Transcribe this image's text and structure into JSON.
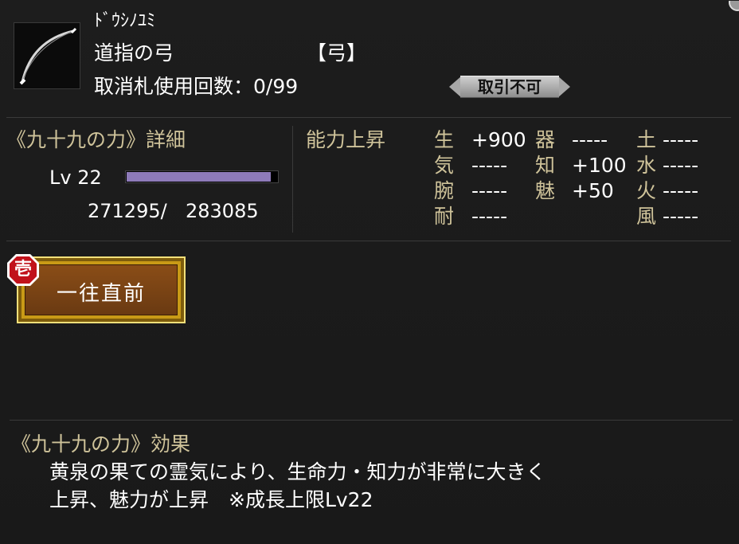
{
  "item": {
    "reading": "ﾄﾞｳｼﾉﾕﾐ",
    "name": "道指の弓",
    "category": "【弓】",
    "cancel_label": "取消札使用回数",
    "cancel_sep": "：",
    "cancel_count": "0/99",
    "trade_status": "取引不可",
    "icon": "bow-icon"
  },
  "power": {
    "title": "《九十九の力》詳細",
    "lv_label": "Lv",
    "lv_value": "22",
    "exp_current": "271295/",
    "exp_max": "283085",
    "exp_fraction": 0.958
  },
  "stats": {
    "header": "能力上昇",
    "rows": [
      [
        {
          "k": "生",
          "v": "+900"
        },
        {
          "k": "器",
          "v": "-----"
        },
        {
          "k": "土",
          "v": "-----"
        }
      ],
      [
        {
          "k": "気",
          "v": "-----"
        },
        {
          "k": "知",
          "v": "+100"
        },
        {
          "k": "水",
          "v": "-----"
        }
      ],
      [
        {
          "k": "腕",
          "v": "-----"
        },
        {
          "k": "魅",
          "v": "+50"
        },
        {
          "k": "火",
          "v": "-----"
        }
      ],
      [
        {
          "k": "耐",
          "v": "-----"
        },
        {
          "k": "",
          "v": ""
        },
        {
          "k": "風",
          "v": "-----"
        }
      ]
    ]
  },
  "skill": {
    "rank_badge": "壱",
    "label": "一往直前"
  },
  "effect": {
    "title": "《九十九の力》効果",
    "line1": "黄泉の果ての霊気により、生命力・知力が非常に大きく",
    "line2": "上昇、魅力が上昇　※成長上限Lv22"
  },
  "colors": {
    "background": "#1b1b1b",
    "header_text": "#cfc39a",
    "exp_bar": "#8e7bb9",
    "button_gold": "#c99a16",
    "button_inner": "#7a4416",
    "badge_red": "#c1121b"
  }
}
